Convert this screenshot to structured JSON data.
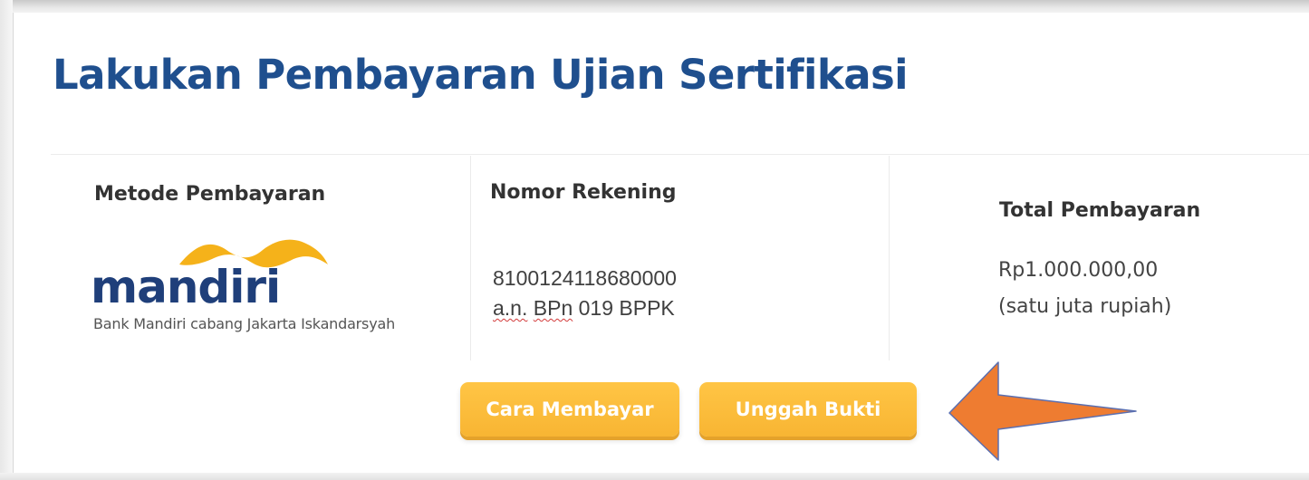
{
  "title": "Lakukan Pembayaran Ujian Sertifikasi",
  "payment_method": {
    "header": "Metode Pembayaran",
    "logo_text": "mandiri",
    "branch": "Bank Mandiri cabang Jakarta Iskandarsyah"
  },
  "account": {
    "header": "Nomor Rekening",
    "number": "8100124118680000",
    "holder_prefix": "a.n.",
    "holder_abbrev": "BPn",
    "holder_rest": "019 BPPK"
  },
  "total": {
    "header": "Total Pembayaran",
    "amount": "Rp1.000.000,00",
    "amount_words": "(satu juta rupiah)"
  },
  "buttons": {
    "how_to_pay": "Cara Membayar",
    "upload_proof": "Unggah Bukti"
  },
  "colors": {
    "title": "#1f4f8e",
    "button": "#f8b533",
    "arrow": "#ee7c31",
    "logo_blue": "#1f3f7a",
    "logo_gold": "#f5b21a"
  },
  "icons": {
    "pointer": "arrow-left-icon"
  }
}
